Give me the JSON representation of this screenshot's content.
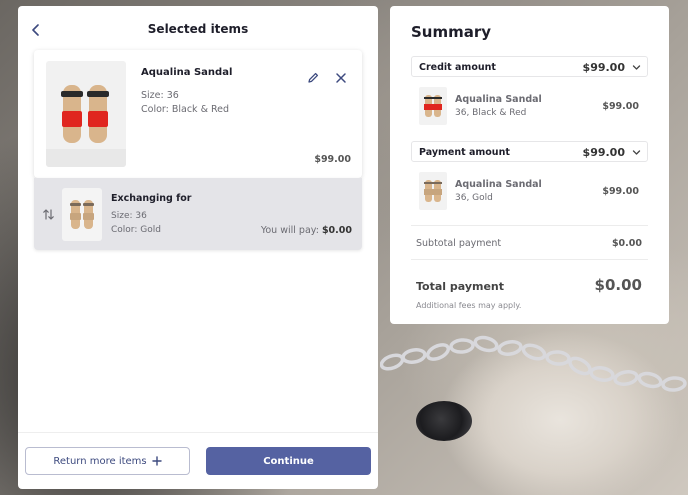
{
  "left_panel": {
    "title": "Selected items",
    "item": {
      "name": "Aqualina Sandal",
      "size": "Size: 36",
      "color": "Color: Black & Red",
      "price": "$99.00"
    },
    "exchange": {
      "title": "Exchanging for",
      "size": "Size: 36",
      "color": "Color: Gold",
      "pay_label": "You will pay:",
      "pay_value": "$0.00"
    },
    "buttons": {
      "return_more": "Return more items",
      "continue": "Continue"
    }
  },
  "summary": {
    "title": "Summary",
    "credit": {
      "label": "Credit amount",
      "value": "$99.00",
      "item_name": "Aqualina Sandal",
      "item_meta": "36, Black & Red",
      "item_price": "$99.00"
    },
    "payment": {
      "label": "Payment amount",
      "value": "$99.00",
      "item_name": "Aqualina Sandal",
      "item_meta": "36, Gold",
      "item_price": "$99.00"
    },
    "subtotal_label": "Subtotal payment",
    "subtotal_value": "$0.00",
    "total_label": "Total payment",
    "total_value": "$0.00",
    "fees_note": "Additional fees may apply."
  },
  "icons": {
    "back": "chevron-left-icon",
    "edit": "pencil-icon",
    "close": "close-icon",
    "swap": "swap-arrows-icon",
    "plus": "plus-icon",
    "chevron": "chevron-down-icon"
  },
  "colors": {
    "primary": "#5562a2",
    "primary_text": "#3d4a7f",
    "exchange_bg": "#e4e4e8",
    "sandal_red": "#e0261f",
    "sandal_gold": "#d9b58c"
  }
}
